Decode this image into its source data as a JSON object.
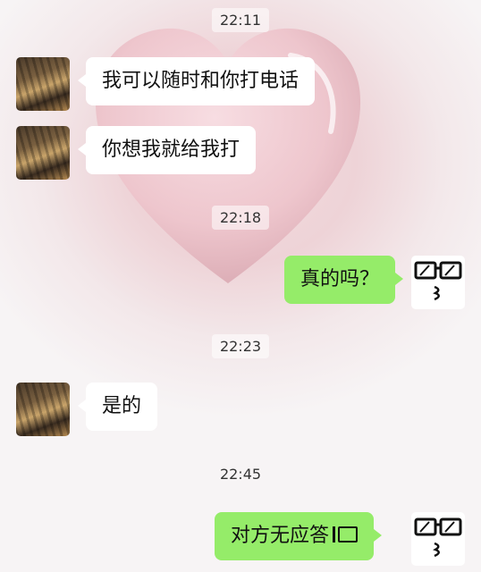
{
  "messages": [
    {
      "kind": "time",
      "text": "22:11"
    },
    {
      "kind": "in",
      "text": "我可以随时和你打电话"
    },
    {
      "kind": "in",
      "text": "你想我就给我打"
    },
    {
      "kind": "time",
      "text": "22:18"
    },
    {
      "kind": "out",
      "text": "真的吗？"
    },
    {
      "kind": "time",
      "text": "22:23"
    },
    {
      "kind": "in",
      "text": "是的"
    },
    {
      "kind": "time",
      "text": "22:45"
    },
    {
      "kind": "out",
      "text": "对方无应答",
      "icon": "missed-call-icon"
    }
  ],
  "colors": {
    "outgoing_bubble": "#95ec69",
    "incoming_bubble": "#ffffff"
  }
}
